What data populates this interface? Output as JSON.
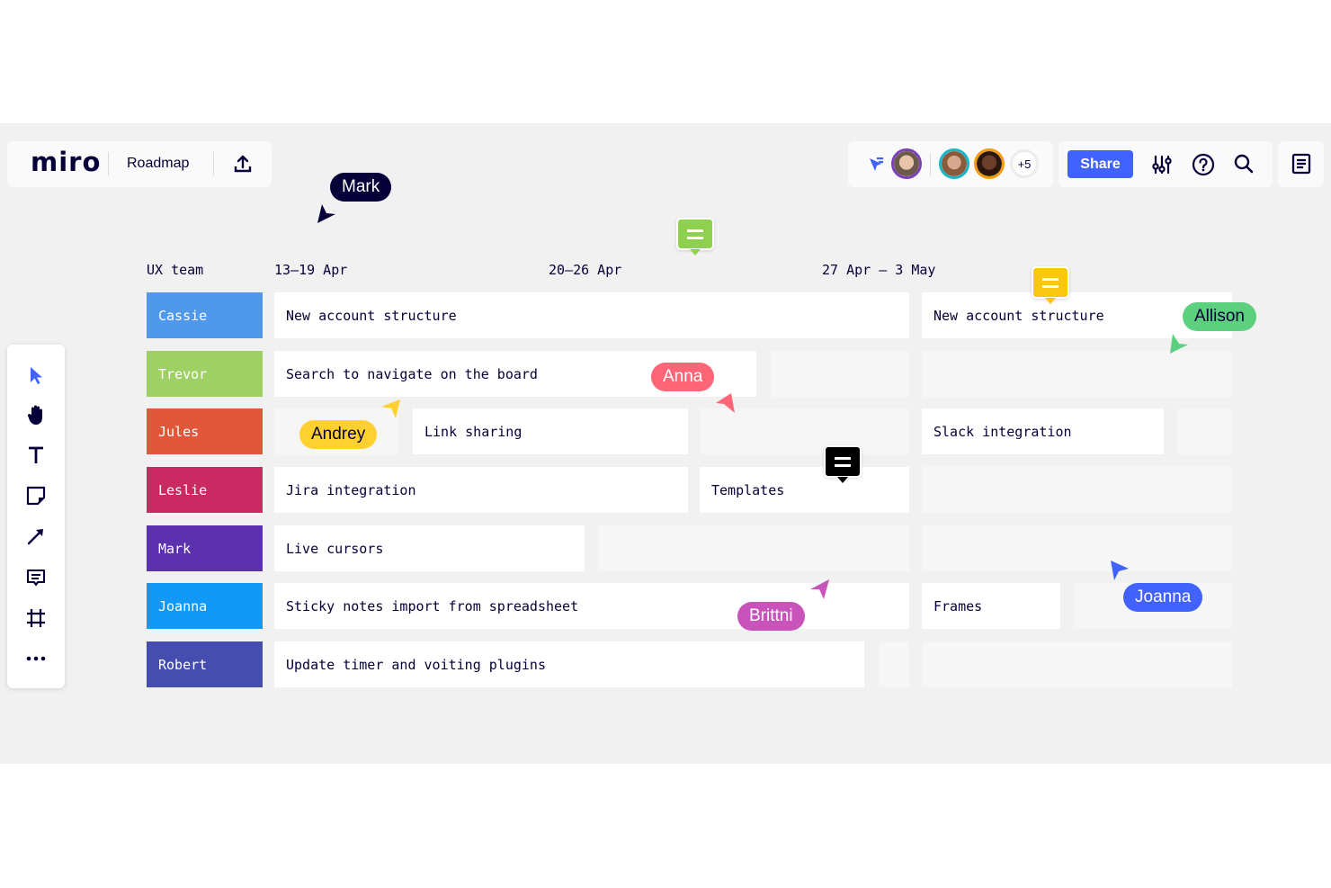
{
  "app": {
    "logo": "miro",
    "board_name": "Roadmap"
  },
  "collab": {
    "extra_count": "+5",
    "avatars": [
      {
        "name": "avatar-user-1",
        "ring": "#7b3fb8",
        "face": "#c9a58a"
      },
      {
        "name": "avatar-user-2",
        "ring": "#16b5c8",
        "face": "#b7846a"
      },
      {
        "name": "avatar-user-3",
        "ring": "#f59a0c",
        "face": "#5a3524"
      }
    ]
  },
  "toolbar_right": {
    "share_label": "Share"
  },
  "colors": {
    "accent": "#4262ff",
    "text": "#050038"
  },
  "board": {
    "team_header": "UX team",
    "weeks": [
      "13–19 Apr",
      "20–26 Apr",
      "27 Apr – 3 May"
    ],
    "people": [
      {
        "name": "Cassie",
        "color": "#4f98ea"
      },
      {
        "name": "Trevor",
        "color": "#9fd064"
      },
      {
        "name": "Jules",
        "color": "#e2563a"
      },
      {
        "name": "Leslie",
        "color": "#c92a62"
      },
      {
        "name": "Mark",
        "color": "#5c31ad"
      },
      {
        "name": "Joanna",
        "color": "#1298f5"
      },
      {
        "name": "Robert",
        "color": "#454daf"
      }
    ],
    "tasks": {
      "cassie_1": "New account structure",
      "cassie_2": "New account structure",
      "trevor_1": "Search to navigate on the board",
      "jules_1": "Link sharing",
      "jules_2": "Slack integration",
      "leslie_1": "Jira integration",
      "leslie_2": "Templates",
      "mark_1": "Live cursors",
      "joanna_1": "Sticky notes import from spreadsheet",
      "joanna_2": "Frames",
      "robert_1": "Update timer and voiting plugins"
    }
  },
  "cursors": [
    {
      "name": "Mark",
      "color": "#050038",
      "text_color": "#ffffff"
    },
    {
      "name": "Anna",
      "color": "#fe6577",
      "text_color": "#ffffff"
    },
    {
      "name": "Andrey",
      "color": "#fed030",
      "text_color": "#050038"
    },
    {
      "name": "Allison",
      "color": "#5cd07e",
      "text_color": "#050038"
    },
    {
      "name": "Brittni",
      "color": "#c853ba",
      "text_color": "#ffffff"
    },
    {
      "name": "Joanna",
      "color": "#4262ff",
      "text_color": "#ffffff"
    }
  ],
  "comments": [
    {
      "color": "#8fd14f"
    },
    {
      "color": "#fac710"
    },
    {
      "color": "#000000"
    }
  ]
}
